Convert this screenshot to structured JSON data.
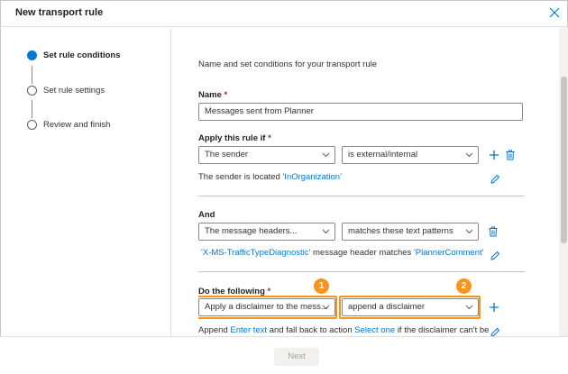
{
  "dialog": {
    "title": "New transport rule"
  },
  "steps": [
    {
      "label": "Set rule conditions",
      "active": true
    },
    {
      "label": "Set rule settings",
      "active": false
    },
    {
      "label": "Review and finish",
      "active": false
    }
  ],
  "content": {
    "description": "Name and set conditions for your transport rule",
    "name_section": {
      "label": "Name",
      "required_mark": "*",
      "value": "Messages sent from Planner"
    },
    "apply_section": {
      "label": "Apply this rule if",
      "required_mark": "*",
      "condition_select": "The sender",
      "operator_select": "is external/internal",
      "summary_prefix": "The sender is located ",
      "summary_link": "'InOrganization'"
    },
    "and_section": {
      "label": "And",
      "condition_select": "The message headers...",
      "operator_select": "matches these text patterns",
      "summary_link1": "'X-MS-TrafficTypeDiagnostic'",
      "summary_middle": " message header matches ",
      "summary_link2": "'PlannerComment'"
    },
    "action_section": {
      "label": "Do the following",
      "required_mark": "*",
      "action_select": "Apply a disclaimer to the mess...",
      "mode_select": "append a disclaimer",
      "summary_prefix": "Append ",
      "summary_link1": "Enter text",
      "summary_middle": " and fall back to action ",
      "summary_link2": "Select one",
      "summary_suffix": " if the disclaimer can't be"
    }
  },
  "callouts": {
    "badge1": "1",
    "badge2": "2",
    "color": "#f7941d"
  },
  "footer": {
    "next_label": "Next"
  },
  "colors": {
    "accent": "#0078d4",
    "required": "#a4262c"
  },
  "icons": [
    "close-icon",
    "chevron-down-icon",
    "add-icon",
    "delete-icon",
    "edit-icon"
  ]
}
